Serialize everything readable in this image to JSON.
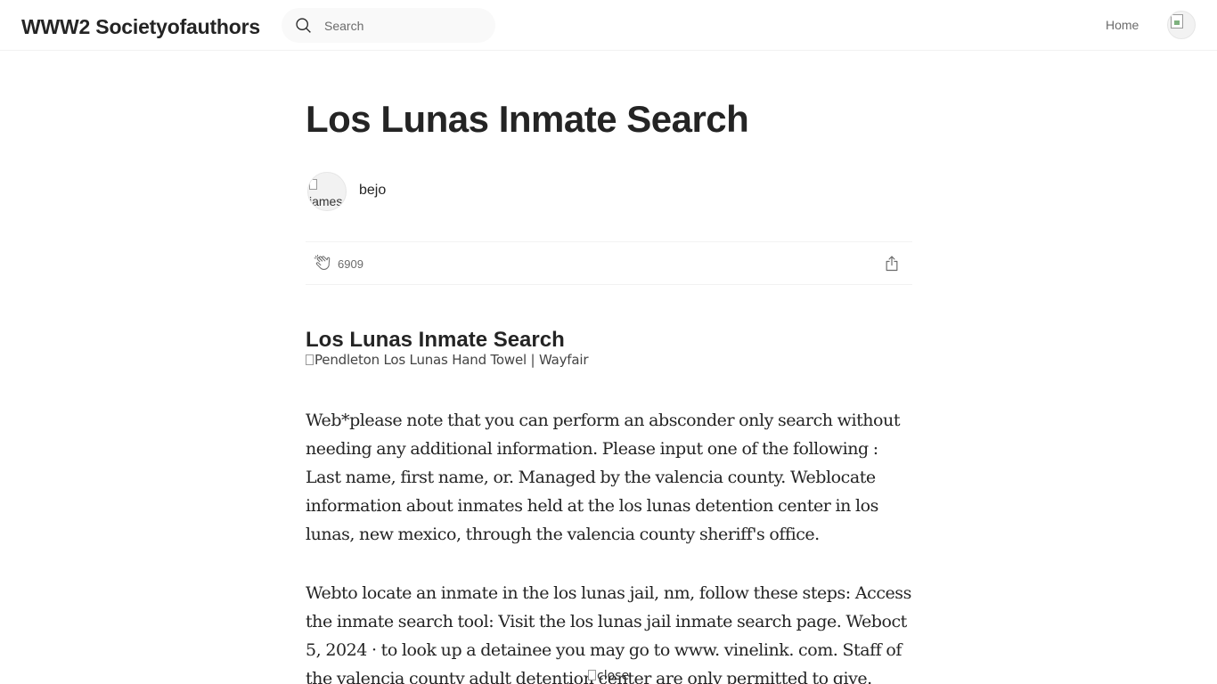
{
  "header": {
    "brand": "WWW2 Societyofauthors",
    "search_placeholder": "Search",
    "nav_home": "Home",
    "avatar_icon": "user-avatar-broken-image"
  },
  "article": {
    "title": "Los Lunas Inmate Search",
    "author": {
      "avatar_alt": "james",
      "name": "bejo"
    },
    "claps": "6909",
    "section_heading": "Los Lunas Inmate Search",
    "image_alt": "Pendleton Los Lunas Hand Towel | Wayfair",
    "paragraphs": [
      "Web*please note that you can perform an absconder only search without needing any additional information. Please input one of the following : Last name, first name, or. Managed by the valencia county. Weblocate information about inmates held at the los lunas detention center in los lunas, new mexico, through the valencia county sheriff's office.",
      "Webto locate an inmate in the los lunas jail, nm, follow these steps: Access the inmate search tool: Visit the los lunas jail inmate search page. Weboct 5, 2024 · to look up a detainee you may go to www. vinelink. com. Staff of the valencia county adult detention center are only permitted to give."
    ],
    "close_alt": "close"
  },
  "colors": {
    "text": "#242424",
    "muted": "#6b6b6b",
    "search_bg": "#f9f9f9",
    "divider": "#f2f2f2"
  }
}
